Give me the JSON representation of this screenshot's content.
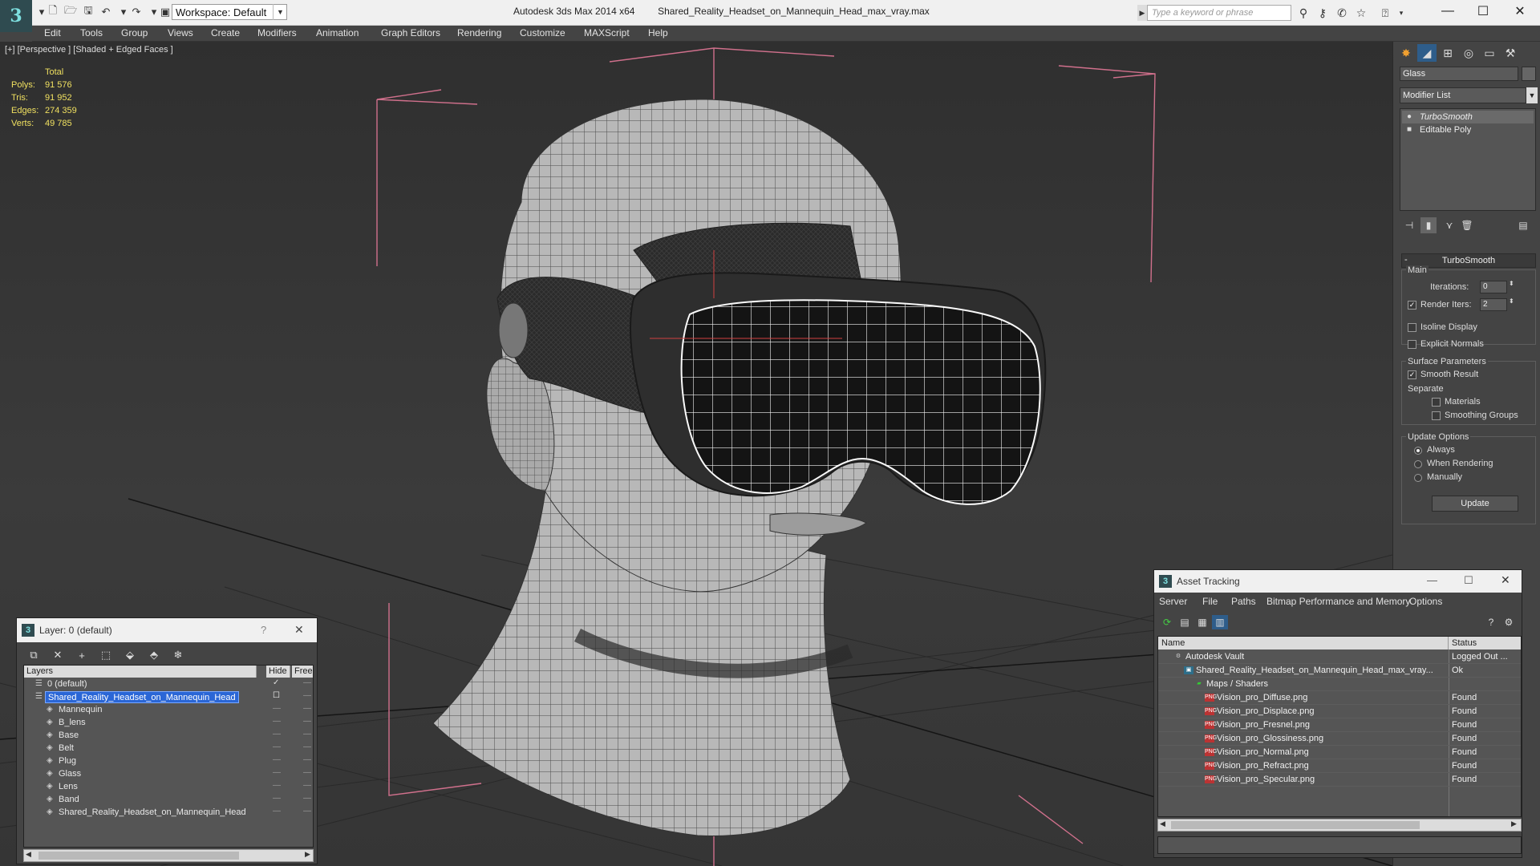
{
  "titlebar": {
    "workspace": "Workspace: Default",
    "app_name": "Autodesk 3ds Max  2014 x64",
    "file_name": "Shared_Reality_Headset_on_Mannequin_Head_max_vray.max",
    "search_placeholder": "Type a keyword or phrase"
  },
  "menubar": [
    "Edit",
    "Tools",
    "Group",
    "Views",
    "Create",
    "Modifiers",
    "Animation",
    "Graph Editors",
    "Rendering",
    "Customize",
    "MAXScript",
    "Help"
  ],
  "viewport": {
    "label": "[+] [Perspective ] [Shaded + Edged Faces ]",
    "stats": {
      "header": "Total",
      "rows": [
        {
          "label": "Polys:",
          "value": "91 576"
        },
        {
          "label": "Tris:",
          "value": "91 952"
        },
        {
          "label": "Edges:",
          "value": "274 359"
        },
        {
          "label": "Verts:",
          "value": "49 785"
        }
      ]
    }
  },
  "command_panel": {
    "object_name": "Glass",
    "modifier_list": "Modifier List",
    "stack": [
      "TurboSmooth",
      "Editable Poly"
    ],
    "rollout_title": "TurboSmooth",
    "main_group": "Main",
    "iterations_label": "Iterations:",
    "iterations_value": "0",
    "render_iters_label": "Render Iters:",
    "render_iters_value": "2",
    "isoline_label": "Isoline Display",
    "explicit_normals_label": "Explicit Normals",
    "surface_group": "Surface Parameters",
    "smooth_result_label": "Smooth Result",
    "separate_label": "Separate",
    "materials_label": "Materials",
    "smoothing_groups_label": "Smoothing Groups",
    "update_group": "Update Options",
    "always_label": "Always",
    "when_rendering_label": "When Rendering",
    "manually_label": "Manually",
    "update_button": "Update"
  },
  "layer_dialog": {
    "title": "Layer: 0 (default)",
    "help": "?",
    "columns": {
      "layers": "Layers",
      "hide": "Hide",
      "freeze": "Free"
    },
    "rows": [
      {
        "name": "0 (default)",
        "indent": 1,
        "selected": false,
        "checked": true
      },
      {
        "name": "Shared_Reality_Headset_on_Mannequin_Head",
        "indent": 1,
        "selected": true,
        "checked": false
      },
      {
        "name": "Mannequin",
        "indent": 2
      },
      {
        "name": "B_lens",
        "indent": 2
      },
      {
        "name": "Base",
        "indent": 2
      },
      {
        "name": "Belt",
        "indent": 2
      },
      {
        "name": "Plug",
        "indent": 2
      },
      {
        "name": "Glass",
        "indent": 2
      },
      {
        "name": "Lens",
        "indent": 2
      },
      {
        "name": "Band",
        "indent": 2
      },
      {
        "name": "Shared_Reality_Headset_on_Mannequin_Head",
        "indent": 2
      }
    ]
  },
  "asset_dialog": {
    "title": "Asset Tracking",
    "menu": [
      "Server",
      "File",
      "Paths",
      "Bitmap Performance and Memory",
      "Options"
    ],
    "columns": {
      "name": "Name",
      "status": "Status"
    },
    "rows": [
      {
        "name": "Autodesk Vault",
        "status": "Logged Out ...",
        "indent": 1,
        "icon": "vault"
      },
      {
        "name": "Shared_Reality_Headset_on_Mannequin_Head_max_vray...",
        "status": "Ok",
        "indent": 2,
        "icon": "max"
      },
      {
        "name": "Maps / Shaders",
        "status": "",
        "indent": 3,
        "icon": "folder"
      },
      {
        "name": "Vision_pro_Diffuse.png",
        "status": "Found",
        "indent": 4,
        "icon": "png"
      },
      {
        "name": "Vision_pro_Displace.png",
        "status": "Found",
        "indent": 4,
        "icon": "png"
      },
      {
        "name": "Vision_pro_Fresnel.png",
        "status": "Found",
        "indent": 4,
        "icon": "png"
      },
      {
        "name": "Vision_pro_Glossiness.png",
        "status": "Found",
        "indent": 4,
        "icon": "png"
      },
      {
        "name": "Vision_pro_Normal.png",
        "status": "Found",
        "indent": 4,
        "icon": "png"
      },
      {
        "name": "Vision_pro_Refract.png",
        "status": "Found",
        "indent": 4,
        "icon": "png"
      },
      {
        "name": "Vision_pro_Specular.png",
        "status": "Found",
        "indent": 4,
        "icon": "png"
      }
    ]
  }
}
